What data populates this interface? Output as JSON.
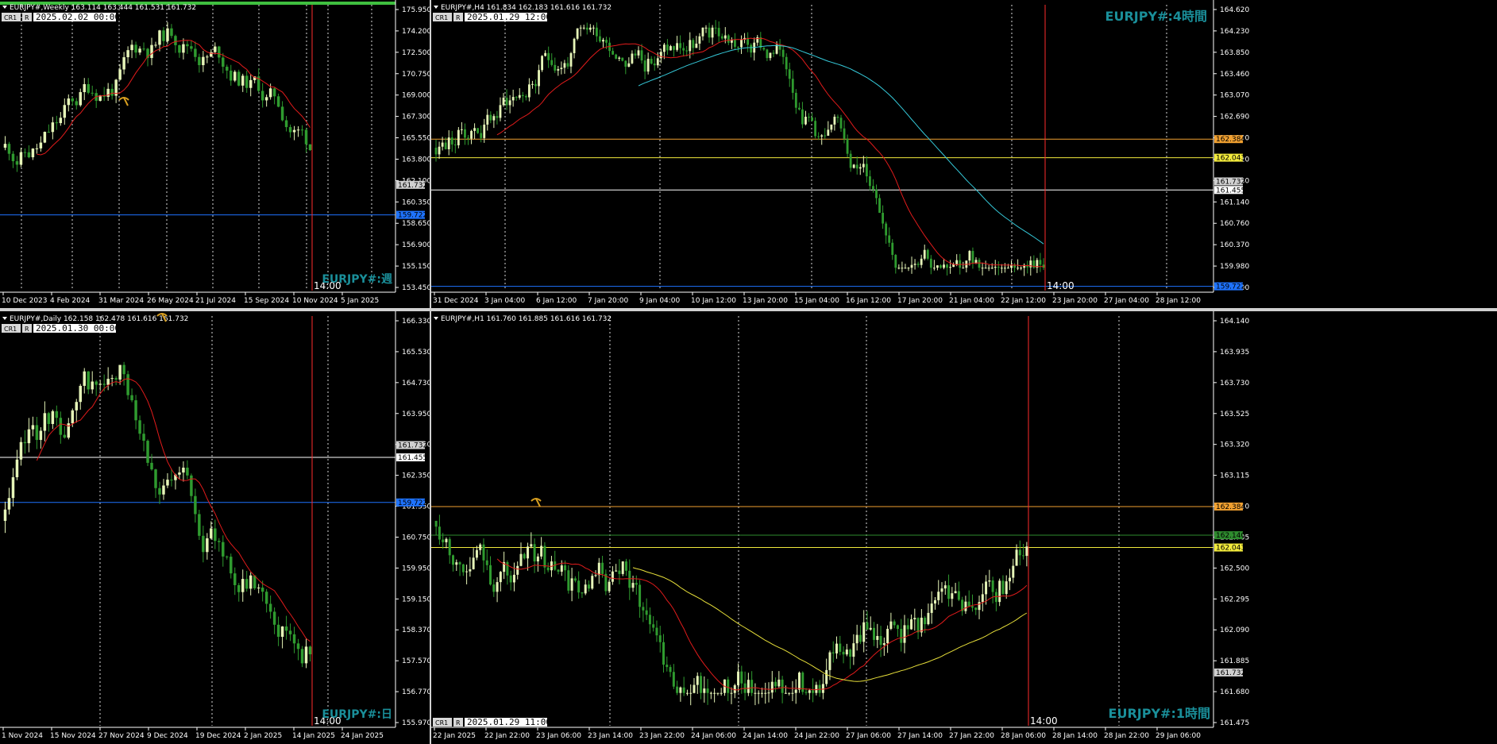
{
  "colors": {
    "background": "#000000",
    "up": "#e6f5b8",
    "down": "#2f9b2f",
    "ma_fast": "#e01b1b",
    "ma_slow_cyan": "#35c9d9",
    "ma_slow_yellow": "#e8e03a",
    "grid": "#d8d8d8",
    "cursor": "#ff2b2b",
    "level_blue": "#1e73ff",
    "level_orange": "#f0a030",
    "level_yellow": "#f2ea3c",
    "level_white": "#ffffff",
    "level_green": "#2e8b2e",
    "watermark": "#1a8f9a"
  },
  "buttons": {
    "cr1": "CR1",
    "r": "R"
  },
  "icons": {
    "chart_menu": "triangle-down-icon",
    "expert": "pickaxe-icon"
  },
  "panels": [
    {
      "id": "weekly",
      "symbol": "EURJPY#,Weekly  163.114 163.444 161.531 161.732",
      "date_box": "2025.02.02 00:00",
      "watermark": "EURJPY#:週",
      "vline_time": "14:00",
      "price_ticks": [
        "175.950",
        "174.200",
        "172.500",
        "170.750",
        "169.000",
        "167.300",
        "165.550",
        "163.800",
        "162.100",
        "160.350",
        "158.650",
        "156.900",
        "155.150",
        "153.450"
      ],
      "time_ticks": [
        "10 Dec 2023",
        "4 Feb 2024",
        "31 Mar 2024",
        "26 May 2024",
        "21 Jul 2024",
        "15 Sep 2024",
        "10 Nov 2024",
        "5 Jan 2025"
      ],
      "price_tags": [
        {
          "label": "161.732",
          "kind": "current"
        },
        {
          "label": "159.722",
          "kind": "blue"
        }
      ],
      "has_cyan_ma": false,
      "has_yellow_ma": false
    },
    {
      "id": "h4",
      "symbol": "EURJPY#,H4  161.834 162.183 161.616 161.732",
      "date_box": "2025.01.29 12:00",
      "watermark": "EURJPY#:4時間",
      "vline_time": "14:00",
      "price_ticks": [
        "164.620",
        "164.230",
        "163.850",
        "163.460",
        "163.070",
        "162.690",
        "162.300",
        "161.920",
        "161.530",
        "161.140",
        "160.760",
        "160.370",
        "159.980",
        "159.600"
      ],
      "time_ticks": [
        "31 Dec 2024",
        "3 Jan 04:00",
        "6 Jan 12:00",
        "7 Jan 20:00",
        "9 Jan 04:00",
        "10 Jan 12:00",
        "13 Jan 20:00",
        "15 Jan 04:00",
        "16 Jan 12:00",
        "17 Jan 20:00",
        "21 Jan 04:00",
        "22 Jan 12:00",
        "23 Jan 20:00",
        "27 Jan 04:00",
        "28 Jan 12:00"
      ],
      "price_tags": [
        {
          "label": "162.384",
          "kind": "orange"
        },
        {
          "label": "162.043",
          "kind": "yellow"
        },
        {
          "label": "161.732",
          "kind": "current"
        },
        {
          "label": "161.455",
          "kind": "white"
        },
        {
          "label": "159.722",
          "kind": "blue"
        }
      ],
      "has_cyan_ma": true,
      "has_yellow_ma": false
    },
    {
      "id": "daily",
      "symbol": "EURJPY#,Daily  162.158 162.478 161.616 161.732",
      "date_box": "2025.01.30 00:00",
      "watermark": "EURJPY#:日",
      "vline_time": "14:00",
      "price_ticks": [
        "166.330",
        "165.530",
        "164.730",
        "163.950",
        "163.150",
        "162.350",
        "161.550",
        "160.750",
        "159.950",
        "159.150",
        "158.370",
        "157.570",
        "156.770",
        "155.970"
      ],
      "time_ticks": [
        "1 Nov 2024",
        "15 Nov 2024",
        "27 Nov 2024",
        "9 Dec 2024",
        "19 Dec 2024",
        "2 Jan 2025",
        "14 Jan 2025",
        "24 Jan 2025"
      ],
      "price_tags": [
        {
          "label": "161.732",
          "kind": "current"
        },
        {
          "label": "161.455",
          "kind": "white"
        },
        {
          "label": "159.722",
          "kind": "blue"
        }
      ],
      "has_cyan_ma": false,
      "has_yellow_ma": false
    },
    {
      "id": "h1",
      "symbol": "EURJPY#,H1  161.760 161.885 161.616 161.732",
      "date_box": "2025.01.29 11:00",
      "watermark": "EURJPY#:1時間",
      "vline_time": "14:00",
      "price_ticks": [
        "164.140",
        "163.935",
        "163.730",
        "163.525",
        "163.320",
        "163.115",
        "162.910",
        "162.705",
        "162.500",
        "162.295",
        "162.090",
        "161.885",
        "161.680",
        "161.475"
      ],
      "time_ticks": [
        "22 Jan 2025",
        "22 Jan 22:00",
        "23 Jan 06:00",
        "23 Jan 14:00",
        "23 Jan 22:00",
        "24 Jan 06:00",
        "24 Jan 14:00",
        "24 Jan 22:00",
        "27 Jan 06:00",
        "27 Jan 14:00",
        "27 Jan 22:00",
        "28 Jan 06:00",
        "28 Jan 14:00",
        "28 Jan 22:00",
        "29 Jan 06:00"
      ],
      "price_tags": [
        {
          "label": "162.384",
          "kind": "orange"
        },
        {
          "label": "162.140",
          "kind": "green"
        },
        {
          "label": "162.043",
          "kind": "yellow"
        },
        {
          "label": "161.732",
          "kind": "current"
        }
      ],
      "has_cyan_ma": false,
      "has_yellow_ma": true
    }
  ]
}
